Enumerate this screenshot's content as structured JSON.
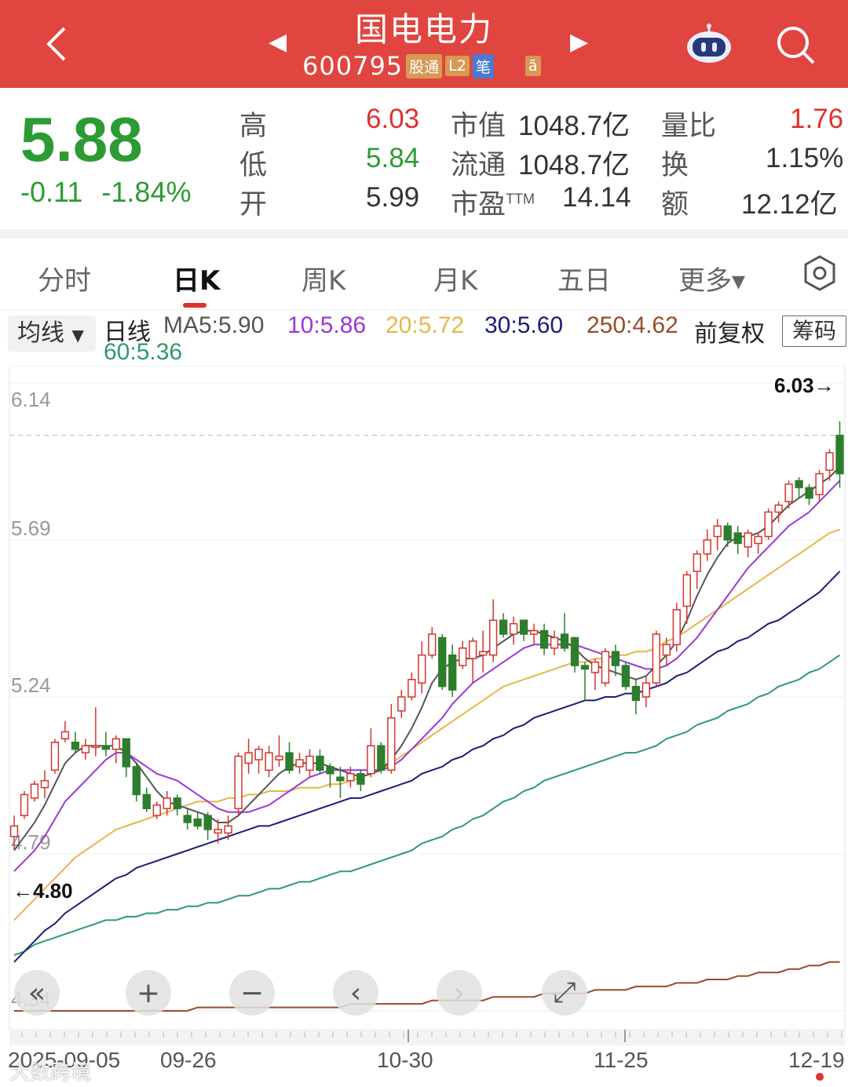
{
  "header": {
    "title": "国电电力",
    "code": "600795",
    "tags": [
      "股通",
      "L2",
      "笔",
      "ā"
    ]
  },
  "quote": {
    "price": "5.88",
    "change": "-0.11",
    "change_pct": "-1.84%",
    "high_label": "高",
    "high": "6.03",
    "low_label": "低",
    "low": "5.84",
    "open_label": "开",
    "open": "5.99",
    "mktcap_label": "市值",
    "mktcap": "1048.7亿",
    "float_label": "流通",
    "float": "1048.7亿",
    "pe_label": "市盈",
    "pe_sup": "TTM",
    "pe": "14.14",
    "volratio_label": "量比",
    "volratio": "1.76",
    "turnover_label": "换",
    "turnover": "1.15%",
    "amount_label": "额",
    "amount": "12.12亿"
  },
  "tabs": [
    "分时",
    "日K",
    "周K",
    "月K",
    "五日",
    "更多▾"
  ],
  "ma_bar": {
    "dropdown": "均线",
    "line_label": "日线",
    "ma5": "MA5:5.90",
    "ma10": "10:5.86",
    "ma20": "20:5.72",
    "ma30": "30:5.60",
    "ma250": "250:4.62",
    "ma60": "60:5.36",
    "adjust": "前复权",
    "chip_btn": "筹码"
  },
  "colors": {
    "up": "#d6342c",
    "down": "#2d7d2d",
    "ma5": "#555555",
    "ma10": "#9b37d6",
    "ma20": "#e6b64a",
    "ma30": "#1c1c7a",
    "ma60": "#2d9b6a",
    "ma250": "#9a4a26"
  },
  "chart_data": {
    "type": "candlestick",
    "y_ticks": [
      "6.14",
      "5.69",
      "5.24",
      "4.79",
      "4.34"
    ],
    "x_ticks": [
      "2025-09-05",
      "09-26",
      "10-30",
      "11-25",
      "12-19"
    ],
    "max_label": "6.03→",
    "min_label": "←4.80",
    "reference_price": 5.99,
    "ylim": [
      4.34,
      6.14
    ],
    "candles": [
      [
        4.84,
        4.87,
        4.8,
        4.9
      ],
      [
        4.9,
        4.96,
        4.89,
        4.97
      ],
      [
        4.95,
        4.99,
        4.94,
        5.0
      ],
      [
        4.98,
        5.0,
        4.95,
        5.03
      ],
      [
        5.03,
        5.11,
        5.02,
        5.12
      ],
      [
        5.12,
        5.14,
        5.11,
        5.17
      ],
      [
        5.11,
        5.09,
        5.08,
        5.14
      ],
      [
        5.08,
        5.1,
        5.06,
        5.12
      ],
      [
        5.1,
        5.1,
        5.07,
        5.21
      ],
      [
        5.1,
        5.09,
        5.07,
        5.14
      ],
      [
        5.09,
        5.12,
        5.05,
        5.13
      ],
      [
        5.12,
        5.04,
        5.01,
        5.12
      ],
      [
        5.04,
        4.96,
        4.94,
        5.05
      ],
      [
        4.96,
        4.92,
        4.91,
        4.98
      ],
      [
        4.9,
        4.93,
        4.89,
        4.94
      ],
      [
        4.92,
        4.95,
        4.9,
        4.97
      ],
      [
        4.95,
        4.92,
        4.9,
        4.96
      ],
      [
        4.9,
        4.88,
        4.86,
        4.92
      ],
      [
        4.89,
        4.87,
        4.86,
        4.91
      ],
      [
        4.9,
        4.86,
        4.83,
        4.91
      ],
      [
        4.85,
        4.86,
        4.82,
        4.89
      ],
      [
        4.85,
        4.87,
        4.83,
        4.9
      ],
      [
        4.92,
        5.07,
        4.9,
        5.08
      ],
      [
        5.05,
        5.08,
        5.02,
        5.12
      ],
      [
        5.06,
        5.09,
        5.02,
        5.1
      ],
      [
        5.03,
        5.08,
        5.01,
        5.1
      ],
      [
        5.06,
        5.07,
        5.04,
        5.13
      ],
      [
        5.08,
        5.03,
        5.02,
        5.11
      ],
      [
        5.04,
        5.06,
        5.02,
        5.08
      ],
      [
        5.03,
        5.07,
        5.01,
        5.09
      ],
      [
        5.07,
        5.03,
        5.02,
        5.09
      ],
      [
        5.04,
        5.02,
        4.98,
        5.05
      ],
      [
        5.01,
        5.0,
        4.95,
        5.04
      ],
      [
        5.0,
        5.02,
        4.98,
        5.04
      ],
      [
        5.02,
        4.99,
        4.97,
        5.03
      ],
      [
        5.02,
        5.1,
        5.01,
        5.15
      ],
      [
        5.1,
        5.03,
        5.02,
        5.11
      ],
      [
        5.03,
        5.18,
        5.02,
        5.22
      ],
      [
        5.2,
        5.24,
        5.18,
        5.26
      ],
      [
        5.24,
        5.29,
        5.23,
        5.31
      ],
      [
        5.28,
        5.36,
        5.25,
        5.4
      ],
      [
        5.36,
        5.42,
        5.35,
        5.44
      ],
      [
        5.41,
        5.27,
        5.26,
        5.42
      ],
      [
        5.36,
        5.26,
        5.24,
        5.39
      ],
      [
        5.33,
        5.38,
        5.32,
        5.4
      ],
      [
        5.35,
        5.4,
        5.28,
        5.41
      ],
      [
        5.36,
        5.37,
        5.31,
        5.43
      ],
      [
        5.36,
        5.46,
        5.34,
        5.52
      ],
      [
        5.46,
        5.42,
        5.41,
        5.48
      ],
      [
        5.42,
        5.45,
        5.39,
        5.47
      ],
      [
        5.46,
        5.42,
        5.4,
        5.46
      ],
      [
        5.42,
        5.43,
        5.39,
        5.45
      ],
      [
        5.43,
        5.38,
        5.36,
        5.45
      ],
      [
        5.38,
        5.41,
        5.36,
        5.43
      ],
      [
        5.42,
        5.38,
        5.37,
        5.48
      ],
      [
        5.41,
        5.33,
        5.31,
        5.41
      ],
      [
        5.33,
        5.32,
        5.23,
        5.34
      ],
      [
        5.31,
        5.34,
        5.26,
        5.35
      ],
      [
        5.28,
        5.37,
        5.27,
        5.38
      ],
      [
        5.37,
        5.33,
        5.3,
        5.39
      ],
      [
        5.33,
        5.27,
        5.26,
        5.34
      ],
      [
        5.27,
        5.23,
        5.19,
        5.29
      ],
      [
        5.24,
        5.28,
        5.21,
        5.3
      ],
      [
        5.28,
        5.42,
        5.27,
        5.43
      ],
      [
        5.36,
        5.39,
        5.33,
        5.41
      ],
      [
        5.39,
        5.49,
        5.37,
        5.51
      ],
      [
        5.5,
        5.59,
        5.45,
        5.6
      ],
      [
        5.6,
        5.65,
        5.55,
        5.66
      ],
      [
        5.65,
        5.69,
        5.63,
        5.72
      ],
      [
        5.7,
        5.73,
        5.66,
        5.75
      ],
      [
        5.73,
        5.69,
        5.67,
        5.74
      ],
      [
        5.71,
        5.68,
        5.65,
        5.73
      ],
      [
        5.67,
        5.71,
        5.64,
        5.72
      ],
      [
        5.68,
        5.7,
        5.65,
        5.71
      ],
      [
        5.7,
        5.77,
        5.69,
        5.78
      ],
      [
        5.77,
        5.79,
        5.74,
        5.8
      ],
      [
        5.8,
        5.85,
        5.78,
        5.86
      ],
      [
        5.86,
        5.84,
        5.81,
        5.87
      ],
      [
        5.84,
        5.81,
        5.79,
        5.85
      ],
      [
        5.82,
        5.88,
        5.8,
        5.89
      ],
      [
        5.89,
        5.94,
        5.86,
        5.95
      ],
      [
        5.99,
        5.88,
        5.84,
        6.03
      ]
    ],
    "ma5": [
      4.8,
      4.84,
      4.88,
      4.93,
      4.99,
      5.05,
      5.08,
      5.1,
      5.1,
      5.1,
      5.1,
      5.08,
      5.05,
      5.01,
      4.97,
      4.94,
      4.93,
      4.92,
      4.91,
      4.9,
      4.88,
      4.88,
      4.9,
      4.93,
      4.96,
      4.99,
      5.02,
      5.04,
      5.05,
      5.05,
      5.05,
      5.04,
      5.03,
      5.02,
      5.01,
      5.02,
      5.03,
      5.06,
      5.1,
      5.15,
      5.21,
      5.28,
      5.32,
      5.34,
      5.35,
      5.35,
      5.36,
      5.38,
      5.4,
      5.42,
      5.43,
      5.43,
      5.42,
      5.41,
      5.4,
      5.38,
      5.35,
      5.33,
      5.32,
      5.31,
      5.3,
      5.29,
      5.3,
      5.33,
      5.36,
      5.4,
      5.46,
      5.53,
      5.59,
      5.64,
      5.68,
      5.7,
      5.7,
      5.71,
      5.73,
      5.76,
      5.79,
      5.81,
      5.83,
      5.85,
      5.87,
      5.9
    ],
    "ma10": [
      4.74,
      4.77,
      4.8,
      4.84,
      4.89,
      4.94,
      4.97,
      5.0,
      5.03,
      5.06,
      5.08,
      5.08,
      5.06,
      5.04,
      5.02,
      5.01,
      5.0,
      4.98,
      4.96,
      4.94,
      4.92,
      4.91,
      4.91,
      4.91,
      4.92,
      4.93,
      4.95,
      4.97,
      4.99,
      5.01,
      5.02,
      5.03,
      5.03,
      5.03,
      5.03,
      5.03,
      5.03,
      5.04,
      5.06,
      5.09,
      5.12,
      5.15,
      5.18,
      5.22,
      5.25,
      5.28,
      5.3,
      5.32,
      5.34,
      5.36,
      5.38,
      5.39,
      5.39,
      5.39,
      5.39,
      5.39,
      5.38,
      5.37,
      5.36,
      5.35,
      5.34,
      5.33,
      5.32,
      5.32,
      5.33,
      5.35,
      5.38,
      5.41,
      5.45,
      5.49,
      5.53,
      5.57,
      5.61,
      5.64,
      5.67,
      5.7,
      5.73,
      5.75,
      5.77,
      5.8,
      5.83,
      5.86
    ],
    "ma20": [
      4.6,
      4.63,
      4.66,
      4.69,
      4.72,
      4.75,
      4.78,
      4.8,
      4.82,
      4.84,
      4.86,
      4.87,
      4.88,
      4.89,
      4.9,
      4.91,
      4.92,
      4.93,
      4.94,
      4.94,
      4.94,
      4.95,
      4.95,
      4.96,
      4.96,
      4.97,
      4.97,
      4.97,
      4.98,
      4.98,
      4.98,
      4.99,
      4.99,
      5.0,
      5.01,
      5.02,
      5.03,
      5.05,
      5.07,
      5.09,
      5.11,
      5.13,
      5.15,
      5.17,
      5.19,
      5.21,
      5.23,
      5.25,
      5.27,
      5.28,
      5.29,
      5.3,
      5.31,
      5.32,
      5.33,
      5.34,
      5.34,
      5.35,
      5.35,
      5.36,
      5.36,
      5.37,
      5.37,
      5.38,
      5.4,
      5.41,
      5.43,
      5.45,
      5.47,
      5.49,
      5.51,
      5.53,
      5.55,
      5.57,
      5.59,
      5.61,
      5.63,
      5.65,
      5.67,
      5.69,
      5.71,
      5.72
    ],
    "ma30": [
      4.48,
      4.51,
      4.54,
      4.57,
      4.59,
      4.62,
      4.64,
      4.66,
      4.68,
      4.7,
      4.72,
      4.73,
      4.75,
      4.76,
      4.77,
      4.78,
      4.79,
      4.8,
      4.81,
      4.82,
      4.83,
      4.84,
      4.85,
      4.86,
      4.87,
      4.87,
      4.88,
      4.89,
      4.9,
      4.91,
      4.92,
      4.93,
      4.94,
      4.95,
      4.95,
      4.96,
      4.97,
      4.98,
      4.99,
      5.0,
      5.02,
      5.03,
      5.04,
      5.06,
      5.07,
      5.09,
      5.1,
      5.12,
      5.13,
      5.15,
      5.16,
      5.18,
      5.19,
      5.2,
      5.21,
      5.22,
      5.23,
      5.23,
      5.24,
      5.24,
      5.25,
      5.25,
      5.26,
      5.27,
      5.28,
      5.3,
      5.31,
      5.33,
      5.35,
      5.37,
      5.38,
      5.4,
      5.41,
      5.43,
      5.45,
      5.46,
      5.48,
      5.5,
      5.52,
      5.54,
      5.57,
      5.6
    ],
    "ma60": [
      4.5,
      4.51,
      4.53,
      4.54,
      4.55,
      4.56,
      4.57,
      4.58,
      4.59,
      4.6,
      4.6,
      4.61,
      4.61,
      4.62,
      4.62,
      4.63,
      4.63,
      4.64,
      4.64,
      4.65,
      4.65,
      4.66,
      4.67,
      4.67,
      4.68,
      4.69,
      4.69,
      4.7,
      4.71,
      4.71,
      4.72,
      4.73,
      4.74,
      4.74,
      4.75,
      4.76,
      4.77,
      4.78,
      4.79,
      4.8,
      4.82,
      4.83,
      4.84,
      4.86,
      4.87,
      4.89,
      4.9,
      4.92,
      4.94,
      4.95,
      4.97,
      4.98,
      5.0,
      5.01,
      5.02,
      5.03,
      5.04,
      5.05,
      5.06,
      5.07,
      5.08,
      5.08,
      5.09,
      5.1,
      5.12,
      5.13,
      5.14,
      5.16,
      5.17,
      5.18,
      5.2,
      5.21,
      5.22,
      5.24,
      5.25,
      5.27,
      5.28,
      5.29,
      5.31,
      5.32,
      5.34,
      5.36
    ],
    "ma250": [
      4.34,
      4.34,
      4.34,
      4.34,
      4.34,
      4.34,
      4.34,
      4.34,
      4.34,
      4.34,
      4.34,
      4.34,
      4.34,
      4.34,
      4.34,
      4.34,
      4.34,
      4.34,
      4.35,
      4.35,
      4.35,
      4.35,
      4.35,
      4.35,
      4.35,
      4.35,
      4.35,
      4.35,
      4.35,
      4.35,
      4.35,
      4.35,
      4.35,
      4.36,
      4.36,
      4.36,
      4.36,
      4.36,
      4.36,
      4.36,
      4.36,
      4.37,
      4.37,
      4.37,
      4.37,
      4.37,
      4.37,
      4.38,
      4.38,
      4.38,
      4.38,
      4.38,
      4.39,
      4.39,
      4.39,
      4.39,
      4.39,
      4.4,
      4.4,
      4.4,
      4.4,
      4.41,
      4.41,
      4.41,
      4.41,
      4.42,
      4.42,
      4.42,
      4.43,
      4.43,
      4.43,
      4.44,
      4.44,
      4.45,
      4.45,
      4.45,
      4.46,
      4.46,
      4.47,
      4.47,
      4.48,
      4.48
    ]
  },
  "controls": [
    "«",
    "+",
    "−",
    "‹",
    "›",
    "⤢"
  ],
  "watermark": "大数跨境"
}
